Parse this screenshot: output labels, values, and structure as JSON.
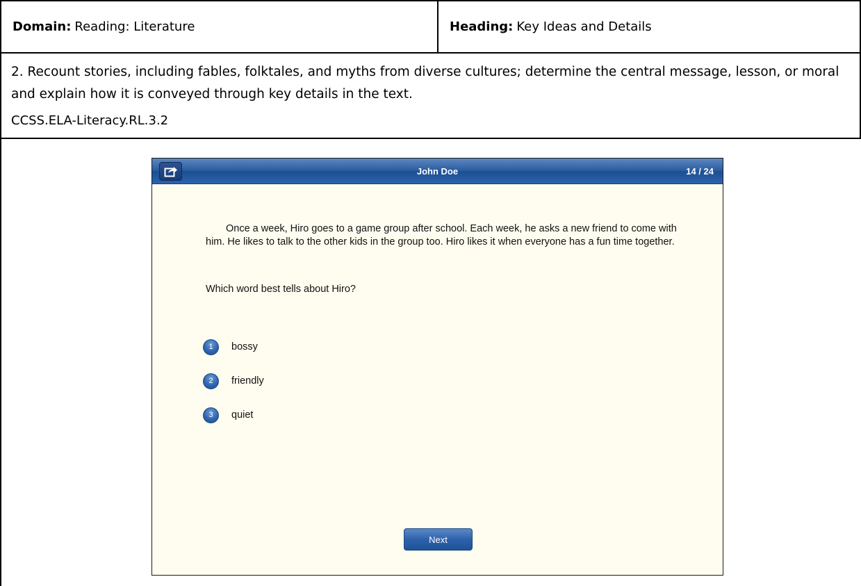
{
  "header": {
    "domain_label": "Domain:",
    "domain_value": "Reading: Literature",
    "heading_label": "Heading:",
    "heading_value": "Key Ideas and Details"
  },
  "standard": {
    "text": "2. Recount stories, including fables, folktales, and myths from diverse cultures; determine the central message, lesson, or moral and explain how it is conveyed through key details in the text.",
    "code": "CCSS.ELA-Literacy.RL.3.2"
  },
  "app": {
    "share_icon": "share-icon",
    "title": "John Doe",
    "progress": "14 / 24",
    "passage": "Once a week, Hiro goes to a game group after school. Each week, he asks a new friend to come with him. He likes to talk to the other kids in the group too. Hiro likes it when everyone has a fun time together.",
    "question": "Which word best tells about Hiro?",
    "choices": [
      {
        "number": "1",
        "label": "bossy"
      },
      {
        "number": "2",
        "label": "friendly"
      },
      {
        "number": "3",
        "label": "quiet"
      }
    ],
    "next_label": "Next",
    "accent_color": "#2d62aa",
    "background_color": "#fffdf0"
  }
}
